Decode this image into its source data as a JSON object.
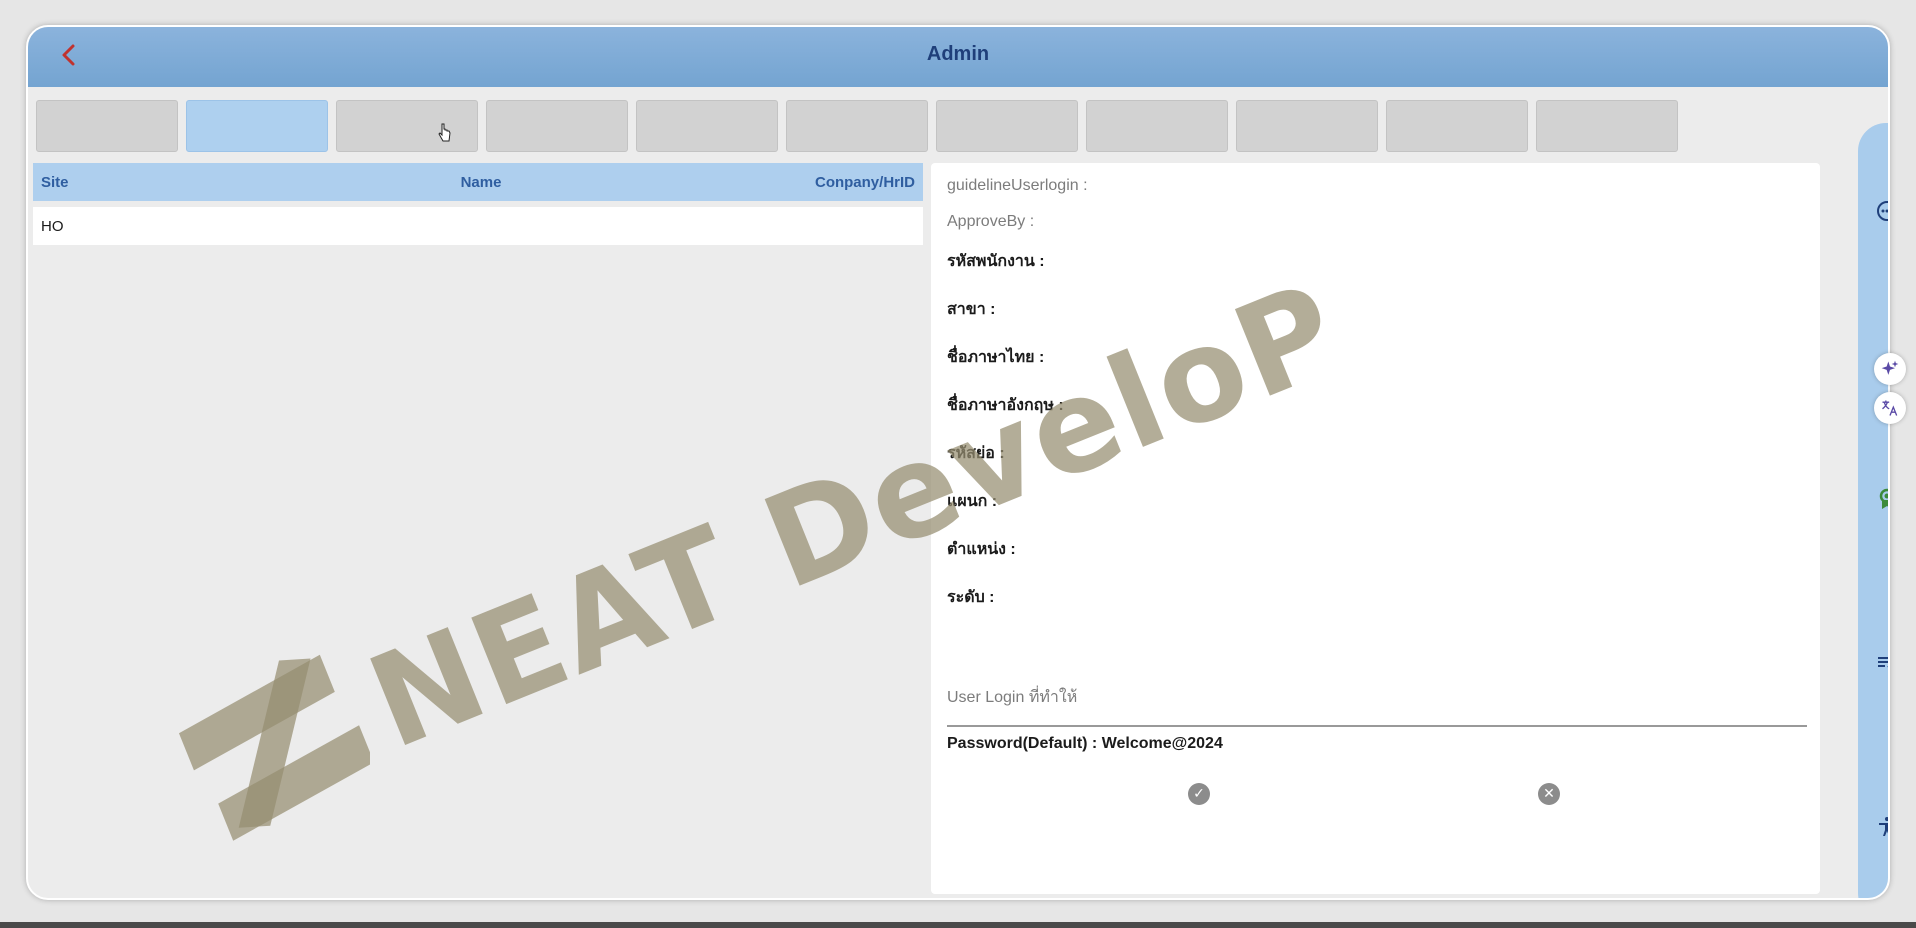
{
  "header": {
    "title": "Admin",
    "back_icon": "chevron-left-icon"
  },
  "tabs": [
    {
      "label": "",
      "active": false
    },
    {
      "label": "",
      "active": true
    },
    {
      "label": "",
      "active": false
    },
    {
      "label": "",
      "active": false
    },
    {
      "label": "",
      "active": false
    },
    {
      "label": "",
      "active": false
    },
    {
      "label": "",
      "active": false
    },
    {
      "label": "",
      "active": false
    },
    {
      "label": "",
      "active": false
    },
    {
      "label": "",
      "active": false
    },
    {
      "label": "",
      "active": false
    }
  ],
  "list": {
    "columns": {
      "site": "Site",
      "name": "Name",
      "company": "Conpany/HrID"
    },
    "rows": [
      {
        "site": "HO",
        "name": "",
        "company": ""
      }
    ]
  },
  "detail": {
    "guideline": "guidelineUserlogin :",
    "approve_by": "ApproveBy :",
    "emp_code": "รหัสพนักงาน :",
    "branch": "สาขา :",
    "thai_name": "ชื่อภาษาไทย :",
    "eng_name": "ชื่อภาษาอังกฤษ :",
    "short_code": "รหัสย่อ :",
    "department": "แผนก :",
    "position": "ตำแหน่ง :",
    "level": "ระดับ :",
    "blurred_line": "",
    "user_login_placeholder": "User Login ที่ทำให้",
    "password_default": "Password(Default) : Welcome@2024"
  },
  "watermark": {
    "text": "NEAT DeveloP"
  },
  "sidebar": {
    "icons": [
      "more-icon",
      "award-icon",
      "playlist-check-icon",
      "accessibility-icon"
    ]
  },
  "floating": {
    "icons": [
      "sparkle-icon",
      "translate-icon"
    ]
  },
  "colors": {
    "header": "#74a4d1",
    "accent": "#aecfee",
    "back": "#c0322e",
    "title": "#1f3f7a"
  }
}
